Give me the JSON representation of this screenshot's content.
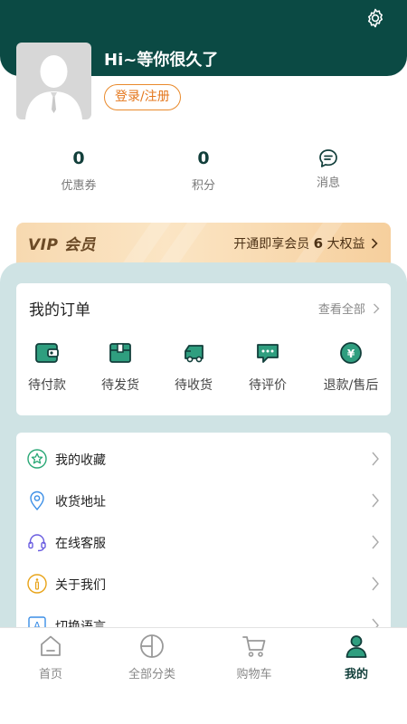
{
  "colors": {
    "header": "#0b4a44",
    "accent_orange": "#e4771d",
    "panel": "#cfe3e4",
    "active_nav": "#123f3b"
  },
  "header": {
    "greeting": "Hi~等你很久了",
    "login_label": "登录/注册"
  },
  "stats": [
    {
      "value": "0",
      "label": "优惠券"
    },
    {
      "value": "0",
      "label": "积分"
    },
    {
      "icon": "message-icon",
      "label": "消息"
    }
  ],
  "vip": {
    "logo": "VIP 会员",
    "text_prefix": "开通即享会员 ",
    "count": "6",
    "text_suffix": " 大权益"
  },
  "orders": {
    "title": "我的订单",
    "view_all": "查看全部",
    "items": [
      {
        "label": "待付款",
        "icon": "wallet-icon"
      },
      {
        "label": "待发货",
        "icon": "box-icon"
      },
      {
        "label": "待收货",
        "icon": "truck-icon"
      },
      {
        "label": "待评价",
        "icon": "comment-icon"
      },
      {
        "label": "退款/售后",
        "icon": "refund-icon"
      }
    ]
  },
  "menu": [
    {
      "label": "我的收藏",
      "icon": "star-icon"
    },
    {
      "label": "收货地址",
      "icon": "location-icon"
    },
    {
      "label": "在线客服",
      "icon": "headset-icon"
    },
    {
      "label": "关于我们",
      "icon": "info-icon"
    },
    {
      "label": "切换语言",
      "icon": "language-icon"
    }
  ],
  "nav": [
    {
      "label": "首页",
      "icon": "home-icon"
    },
    {
      "label": "全部分类",
      "icon": "category-icon"
    },
    {
      "label": "购物车",
      "icon": "cart-icon"
    },
    {
      "label": "我的",
      "icon": "user-icon",
      "active": true
    }
  ]
}
